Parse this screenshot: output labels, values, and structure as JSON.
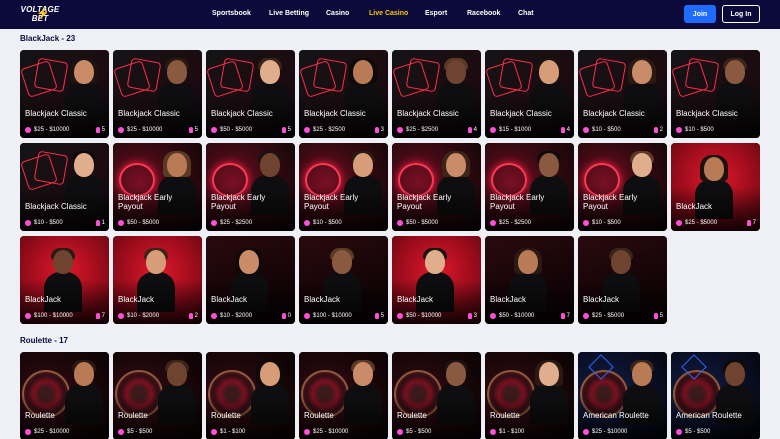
{
  "header": {
    "logo_line1": "VOLTAGE",
    "logo_line2": "BET",
    "nav": [
      {
        "label": "Sportsbook",
        "active": false
      },
      {
        "label": "Live Betting",
        "active": false
      },
      {
        "label": "Casino",
        "active": false
      },
      {
        "label": "Live Casino",
        "active": true
      },
      {
        "label": "Esport",
        "active": false
      },
      {
        "label": "Racebook",
        "active": false
      },
      {
        "label": "Chat",
        "active": false
      }
    ],
    "join_label": "Join",
    "login_label": "Log In"
  },
  "colors": {
    "nav_bg": "#0b0a3b",
    "active_nav": "#f7c600",
    "join_bg": "#1f6bff",
    "accent": "#ff4fd8"
  },
  "sections": [
    {
      "title": "BlackJack - 23",
      "games": [
        {
          "title": "Blackjack Classic",
          "limit": "$25 - $10000",
          "players": "5",
          "theme": "classic"
        },
        {
          "title": "Blackjack Classic",
          "limit": "$25 - $10000",
          "players": "5",
          "theme": "classic"
        },
        {
          "title": "Blackjack Classic",
          "limit": "$50 - $5000",
          "players": "5",
          "theme": "classic"
        },
        {
          "title": "Blackjack Classic",
          "limit": "$25 - $2500",
          "players": "3",
          "theme": "classic"
        },
        {
          "title": "Blackjack Classic",
          "limit": "$25 - $2500",
          "players": "4",
          "theme": "classic"
        },
        {
          "title": "Blackjack Classic",
          "limit": "$15 - $1000",
          "players": "4",
          "theme": "classic"
        },
        {
          "title": "Blackjack Classic",
          "limit": "$10 - $500",
          "players": "2",
          "theme": "classic"
        },
        {
          "title": "Blackjack Classic",
          "limit": "$10 - $500",
          "players": "",
          "theme": "classic"
        },
        {
          "title": "Blackjack Classic",
          "limit": "$10 - $500",
          "players": "1",
          "theme": "classic"
        },
        {
          "title": "Blackjack Early Payout",
          "limit": "$50 - $5000",
          "players": "",
          "theme": "early"
        },
        {
          "title": "Blackjack Early Payout",
          "limit": "$25 - $2500",
          "players": "",
          "theme": "early"
        },
        {
          "title": "Blackjack Early Payout",
          "limit": "$10 - $500",
          "players": "",
          "theme": "early"
        },
        {
          "title": "Blackjack Early Payout",
          "limit": "$50 - $5000",
          "players": "",
          "theme": "early"
        },
        {
          "title": "Blackjack Early Payout",
          "limit": "$25 - $2500",
          "players": "",
          "theme": "early"
        },
        {
          "title": "Blackjack Early Payout",
          "limit": "$10 - $500",
          "players": "",
          "theme": "early"
        },
        {
          "title": "BlackJack",
          "limit": "$25 - $5000",
          "players": "7",
          "theme": "red"
        },
        {
          "title": "BlackJack",
          "limit": "$100 - $10000",
          "players": "7",
          "theme": "red"
        },
        {
          "title": "BlackJack",
          "limit": "$10 - $2000",
          "players": "2",
          "theme": "red"
        },
        {
          "title": "BlackJack",
          "limit": "$10 - $2000",
          "players": "0",
          "theme": "dark"
        },
        {
          "title": "BlackJack",
          "limit": "$100 - $10000",
          "players": "5",
          "theme": "dark"
        },
        {
          "title": "BlackJack",
          "limit": "$50 - $10000",
          "players": "3",
          "theme": "red"
        },
        {
          "title": "BlackJack",
          "limit": "$50 - $10000",
          "players": "7",
          "theme": "dark"
        },
        {
          "title": "BlackJack",
          "limit": "$25 - $5000",
          "players": "5",
          "theme": "dark"
        }
      ]
    },
    {
      "title": "Roulette - 17",
      "games": [
        {
          "title": "Roulette",
          "limit": "$25 - $10000",
          "players": "",
          "theme": "roulette"
        },
        {
          "title": "Roulette",
          "limit": "$5 - $500",
          "players": "",
          "theme": "roulette"
        },
        {
          "title": "Roulette",
          "limit": "$1 - $100",
          "players": "",
          "theme": "roulette"
        },
        {
          "title": "Roulette",
          "limit": "$25 - $10000",
          "players": "",
          "theme": "roulette"
        },
        {
          "title": "Roulette",
          "limit": "$5 - $500",
          "players": "",
          "theme": "roulette"
        },
        {
          "title": "Roulette",
          "limit": "$1 - $100",
          "players": "",
          "theme": "roulette"
        },
        {
          "title": "American Roulette",
          "limit": "$25 - $10000",
          "players": "",
          "theme": "american"
        },
        {
          "title": "American Roulette",
          "limit": "$5 - $500",
          "players": "",
          "theme": "american"
        }
      ]
    }
  ]
}
